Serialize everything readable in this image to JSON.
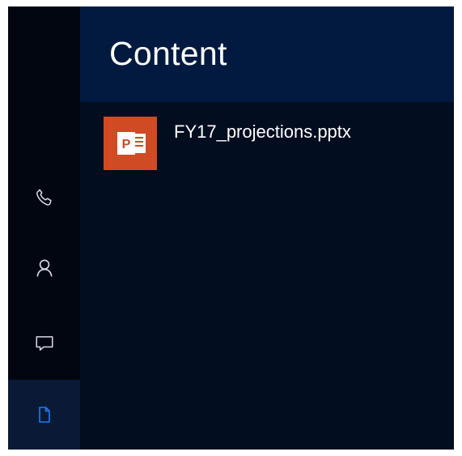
{
  "colors": {
    "background": "#020d1f",
    "rail": "#010611",
    "header": "#031a40",
    "rail_selected": "#0a1a36",
    "accent": "#1e7cf0",
    "powerpoint": "#d04a24"
  },
  "rail": {
    "items": [
      {
        "icon": "phone-icon",
        "selected": false
      },
      {
        "icon": "person-icon",
        "selected": false
      },
      {
        "icon": "chat-icon",
        "selected": false
      },
      {
        "icon": "document-icon",
        "selected": true
      }
    ]
  },
  "main": {
    "title": "Content",
    "files": [
      {
        "name": "FY17_projections.pptx",
        "icon": "powerpoint-file-icon",
        "icon_letter": "P"
      }
    ]
  }
}
